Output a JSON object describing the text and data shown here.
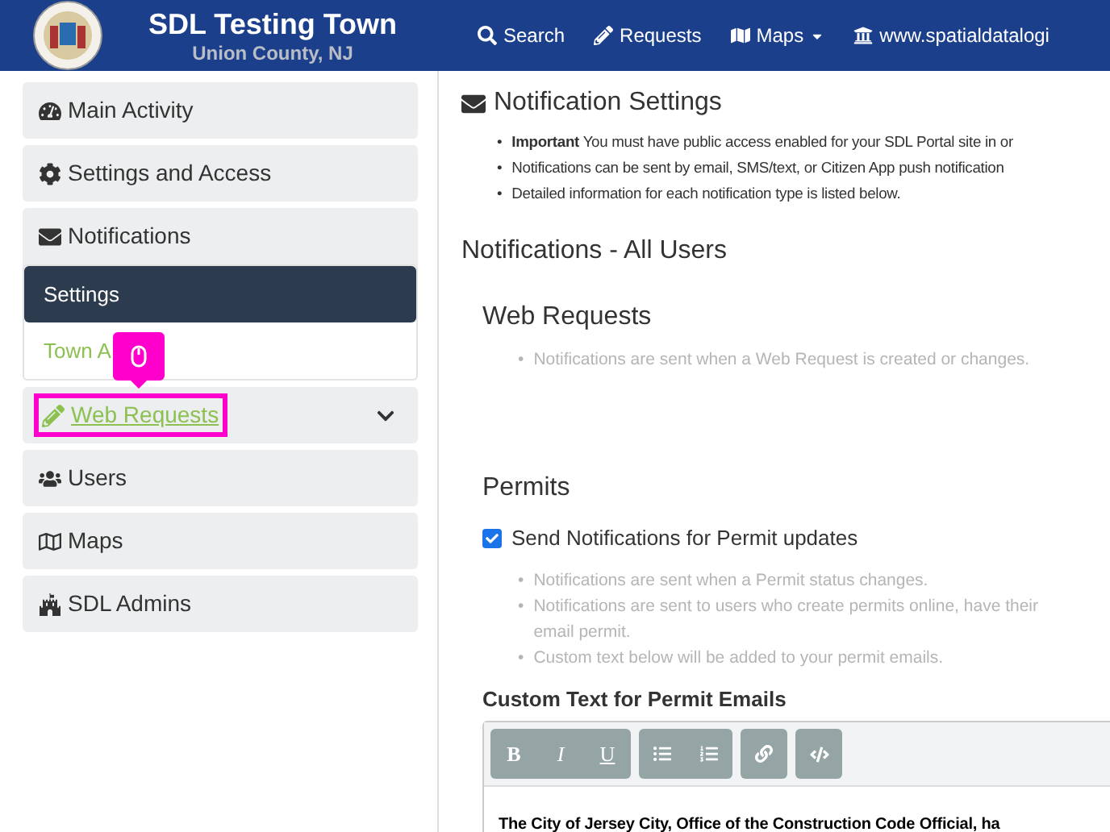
{
  "header": {
    "title": "SDL Testing Town",
    "subtitle": "Union County, NJ",
    "nav": [
      {
        "label": "Search",
        "dropdown": false
      },
      {
        "label": "Requests",
        "dropdown": false
      },
      {
        "label": "Maps",
        "dropdown": true
      },
      {
        "label": "www.spatialdatalogi",
        "dropdown": false
      }
    ]
  },
  "sidebar": {
    "items": [
      {
        "label": "Main Activity"
      },
      {
        "label": "Settings and Access"
      },
      {
        "label": "Notifications",
        "expanded": true,
        "children": [
          {
            "label": "Settings",
            "selected": true
          },
          {
            "label": "Town A",
            "selected": false
          }
        ]
      },
      {
        "label": "Web Requests",
        "expanded": false,
        "highlighted": true
      },
      {
        "label": "Users"
      },
      {
        "label": "Maps"
      },
      {
        "label": "SDL Admins"
      }
    ]
  },
  "main": {
    "bullet": "•",
    "title": "Notification Settings",
    "intro": [
      "**Important** You must have public access enabled for your SDL Portal site in or",
      "Notifications can be sent by email, SMS/text, or Citizen App push notification",
      "Detailed information for each notification type is listed below."
    ],
    "section_title": "Notifications - All Users",
    "web_requests": {
      "title": "Web Requests",
      "notes": [
        "Notifications are sent when a Web Request is created or changes."
      ]
    },
    "permits": {
      "title": "Permits",
      "checkbox": {
        "label": "Send Notifications for Permit updates",
        "checked": true
      },
      "notes": [
        "Notifications are sent when a Permit status changes.",
        "Notifications are sent to users who create permits online, have their email permit.",
        "Custom text below will be added to your permit emails."
      ],
      "editor": {
        "label": "Custom Text for Permit Emails",
        "format_buttons": [
          "B",
          "I",
          "U"
        ],
        "content": "The City of Jersey City, Office of the Construction Code Official, ha"
      }
    }
  }
}
